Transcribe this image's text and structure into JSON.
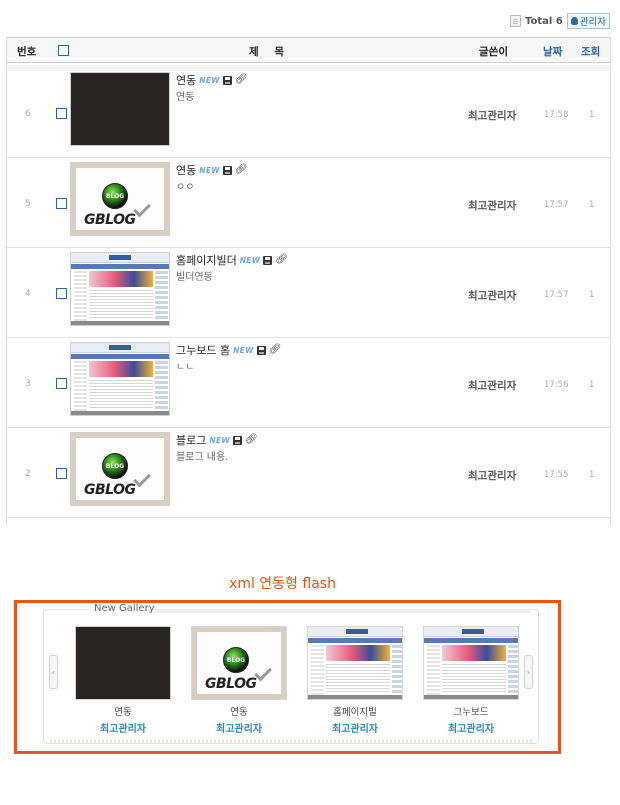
{
  "topbar": {
    "total": "Total 6",
    "admin_label": "관리자"
  },
  "table": {
    "headers": {
      "no": "번호",
      "title": "제 목",
      "writer": "글쓴이",
      "date": "날짜",
      "hits": "조회"
    },
    "rows": [
      {
        "no": "6",
        "title": "연동",
        "subtitle": "연동",
        "writer": "최고관리자",
        "time": "17:58",
        "hits": "1",
        "badge": "NEW",
        "thumb": "dark-image"
      },
      {
        "no": "5",
        "title": "연동",
        "subtitle": "ㅇㅇ",
        "writer": "최고관리자",
        "time": "17:57",
        "hits": "1",
        "badge": "NEW",
        "thumb": "gblog-logo"
      },
      {
        "no": "4",
        "title": "홈페이지빌더",
        "subtitle": "빌더연동",
        "writer": "최고관리자",
        "time": "17:57",
        "hits": "1",
        "badge": "NEW",
        "thumb": "website-screenshot"
      },
      {
        "no": "3",
        "title": "그누보드 홈",
        "subtitle": "ㄴㄴ",
        "writer": "최고관리자",
        "time": "17:56",
        "hits": "1",
        "badge": "NEW",
        "thumb": "website-screenshot"
      },
      {
        "no": "2",
        "title": "블로그",
        "subtitle": "블로그 내용.",
        "writer": "최고관리자",
        "time": "17:55",
        "hits": "1",
        "badge": "NEW",
        "thumb": "gblog-logo"
      }
    ]
  },
  "flash": {
    "caption": "xml 연동형 flash",
    "legend": "New Gallery",
    "items": [
      {
        "title": "연동",
        "writer": "최고관리자",
        "thumb": "dark-image"
      },
      {
        "title": "연동",
        "writer": "최고관리자",
        "thumb": "gblog-logo"
      },
      {
        "title": "홈페이지빌",
        "writer": "최고관리자",
        "thumb": "website-screenshot"
      },
      {
        "title": "그누보드",
        "writer": "최고관리자",
        "thumb": "website-screenshot"
      }
    ]
  },
  "thumb_logo_text": "GBLOG",
  "thumb_ball_text": "BLOG",
  "colors": {
    "accent_blue": "#2a62a8",
    "flash_orange": "#ea5414",
    "writer_blue": "#2a8ac4"
  },
  "icons": [
    "document-icon",
    "lightbulb-icon",
    "checkbox-icon",
    "new-badge-icon",
    "disk-icon",
    "paperclip-icon",
    "chevron-left-icon",
    "chevron-right-icon"
  ]
}
